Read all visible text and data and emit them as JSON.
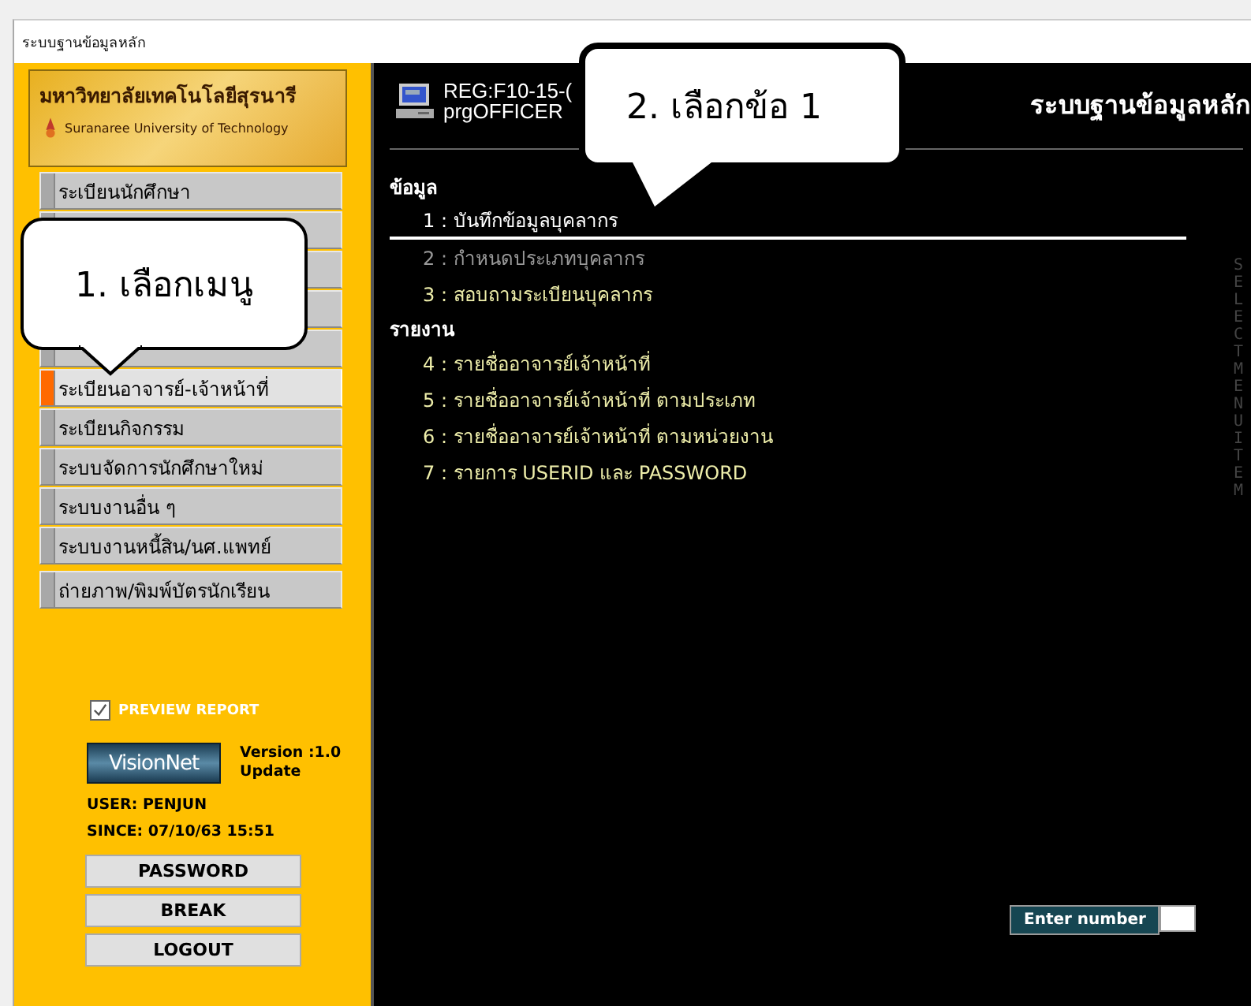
{
  "window": {
    "title": "ระบบฐานข้อมูลหลัก"
  },
  "logo": {
    "thai_name": "มหาวิทยาลัยเทคโนโลยีสุรนารี",
    "english_name": "Suranaree University of Technology"
  },
  "sidebar": {
    "items": [
      {
        "label": "ระเบียนนักศึกษา",
        "selected": false
      },
      {
        "selected": false
      },
      {
        "selected": false
      },
      {
        "selected": false
      },
      {
        "selected": false
      },
      {
        "label": "ระเบียนอาจารย์-เจ้าหน้าที่",
        "selected": true
      },
      {
        "label": "ระเบียนกิจกรรม",
        "selected": false
      },
      {
        "label": "ระบบจัดการนักศึกษาใหม่",
        "selected": false
      },
      {
        "label": "ระบบงานอื่น ๆ",
        "selected": false
      },
      {
        "label": "ระบบงานหนี้สิน/นศ.แพทย์",
        "selected": false
      },
      {
        "label": "ถ่ายภาพ/พิมพ์บัตรนักเรียน",
        "selected": false
      }
    ]
  },
  "preview_report": {
    "label": "PREVIEW REPORT",
    "checked": true
  },
  "brand": {
    "logo_text": "VisionNet",
    "version": "Version :1.0",
    "update": "Update"
  },
  "user": "USER: PENJUN",
  "since": "SINCE: 07/10/63 15:51",
  "buttons": [
    "PASSWORD",
    "BREAK",
    "LOGOUT"
  ],
  "header": {
    "form_id": "REG:F10-15-(",
    "program": "prgOFFICER",
    "title": "ระบบฐานข้อมูลหลัก"
  },
  "sections": [
    {
      "heading": "ข้อมูล",
      "items": [
        {
          "label": "1 : บันทึกข้อมูลบุคลากร",
          "selected": true,
          "disabled": false
        },
        {
          "label": "2 : กำหนดประเภทบุคลากร",
          "selected": false,
          "disabled": true
        },
        {
          "label": "3 : สอบถามระเบียนบุคลากร",
          "selected": false,
          "disabled": false
        }
      ]
    },
    {
      "heading": "รายงาน",
      "items": [
        {
          "label": "4 : รายชื่ออาจารย์เจ้าหน้าที่",
          "selected": false,
          "disabled": false
        },
        {
          "label": "5 : รายชื่ออาจารย์เจ้าหน้าที่ ตามประเภท",
          "selected": false,
          "disabled": false
        },
        {
          "label": "6 : รายชื่ออาจารย์เจ้าหน้าที่ ตามหน่วยงาน",
          "selected": false,
          "disabled": false
        },
        {
          "label": "7 : รายการ USERID และ PASSWORD",
          "selected": false,
          "disabled": false
        }
      ]
    }
  ],
  "side_caption": "SELECT MENU ITEM",
  "enter_number": {
    "label": "Enter number"
  },
  "callouts": [
    "1. เลือกเมนู",
    "2. เลือกข้อ 1"
  ]
}
